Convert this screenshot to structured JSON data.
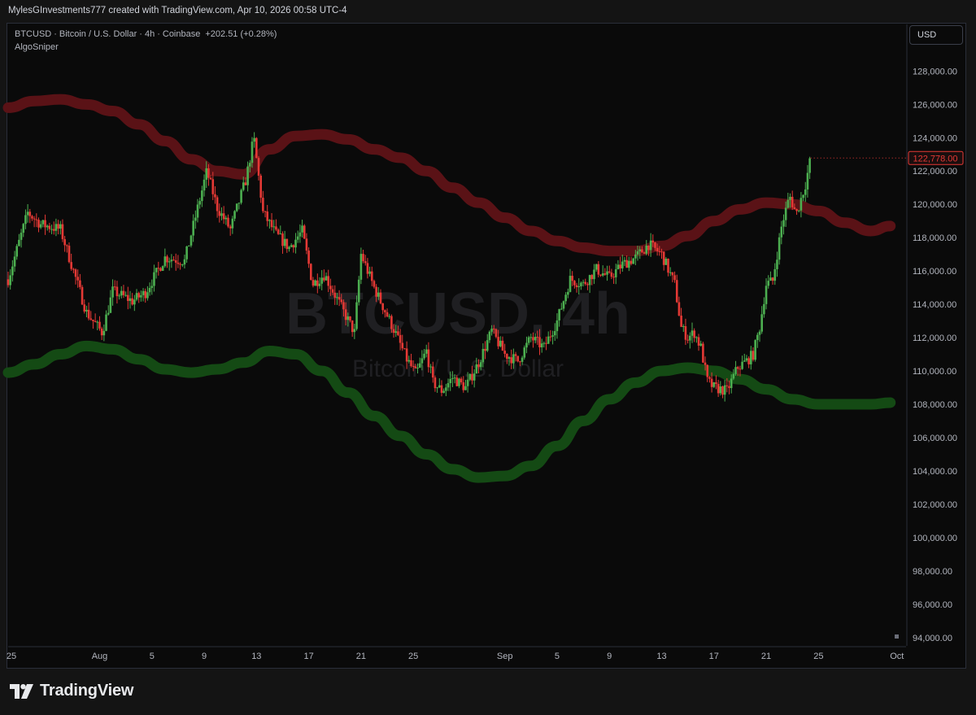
{
  "caption": "MylesGInvestments777 created with TradingView.com, Apr 10, 2026 00:58 UTC-4",
  "legend": {
    "symbol": "BTCUSD",
    "name": "Bitcoin / U.S. Dollar",
    "interval": "4h",
    "exchange": "Coinbase",
    "change": "+202.51 (+0.28%)",
    "indicator": "AlgoSniper"
  },
  "currency_button": "USD",
  "watermark": {
    "line1": "BTCUSD, 4h",
    "line2": "Bitcoin / U.S. Dollar"
  },
  "last_price_label": "122,778.00",
  "brand": "TradingView",
  "colors": {
    "background": "#0a0a0a",
    "up_candle": "#4caf50",
    "down_candle": "#e53935",
    "upper_band": "#5a1216",
    "lower_band": "#144a14",
    "price_label": "#e53935"
  },
  "chart_data": {
    "type": "candlestick",
    "symbol": "BTCUSD",
    "interval": "4h",
    "ylim": [
      93500,
      130800
    ],
    "y_ticks": [
      128000,
      126000,
      124000,
      122000,
      120000,
      118000,
      116000,
      114000,
      112000,
      110000,
      108000,
      106000,
      104000,
      102000,
      100000,
      98000,
      96000,
      94000
    ],
    "y_tick_labels": [
      "128,000.00",
      "126,000.00",
      "124,000.00",
      "122,000.00",
      "120,000.00",
      "118,000.00",
      "116,000.00",
      "114,000.00",
      "112,000.00",
      "110,000.00",
      "108,000.00",
      "106,000.00",
      "104,000.00",
      "102,000.00",
      "100,000.00",
      "98,000.00",
      "96,000.00",
      "94,000.00"
    ],
    "x_axis": {
      "start_day": 25,
      "labels": [
        {
          "text": "25",
          "day": 25
        },
        {
          "text": "Aug",
          "day": 32
        },
        {
          "text": "5",
          "day": 36
        },
        {
          "text": "9",
          "day": 40
        },
        {
          "text": "13",
          "day": 44
        },
        {
          "text": "17",
          "day": 48
        },
        {
          "text": "21",
          "day": 52
        },
        {
          "text": "25",
          "day": 56
        },
        {
          "text": "Sep",
          "day": 63
        },
        {
          "text": "5",
          "day": 67
        },
        {
          "text": "9",
          "day": 71
        },
        {
          "text": "13",
          "day": 75
        },
        {
          "text": "17",
          "day": 79
        },
        {
          "text": "21",
          "day": 83
        },
        {
          "text": "25",
          "day": 87
        },
        {
          "text": "Oct",
          "day": 93
        }
      ]
    },
    "price_path": [
      [
        25,
        115500
      ],
      [
        26.5,
        119500
      ],
      [
        27.5,
        118800
      ],
      [
        29,
        118500
      ],
      [
        30,
        116000
      ],
      [
        31,
        113500
      ],
      [
        32.2,
        112300
      ],
      [
        33,
        114800
      ],
      [
        34.5,
        114200
      ],
      [
        35.5,
        114700
      ],
      [
        37,
        116800
      ],
      [
        38.5,
        116600
      ],
      [
        40.2,
        122000
      ],
      [
        41,
        119800
      ],
      [
        42,
        118500
      ],
      [
        43.2,
        121500
      ],
      [
        43.8,
        124000
      ],
      [
        44.5,
        119500
      ],
      [
        45.5,
        118200
      ],
      [
        46.5,
        117400
      ],
      [
        47.5,
        118400
      ],
      [
        48.3,
        115200
      ],
      [
        49.2,
        115800
      ],
      [
        50.5,
        113800
      ],
      [
        51.5,
        112300
      ],
      [
        52,
        117000
      ],
      [
        53,
        115000
      ],
      [
        54.5,
        112500
      ],
      [
        55.5,
        110700
      ],
      [
        56.2,
        109800
      ],
      [
        57,
        111200
      ],
      [
        57.5,
        109300
      ],
      [
        58.2,
        108800
      ],
      [
        59,
        109600
      ],
      [
        60,
        109000
      ],
      [
        61,
        110500
      ],
      [
        62,
        112400
      ],
      [
        63,
        111000
      ],
      [
        64,
        110600
      ],
      [
        65,
        112000
      ],
      [
        66,
        111400
      ],
      [
        67,
        113000
      ],
      [
        68,
        115500
      ],
      [
        69,
        115200
      ],
      [
        70,
        116100
      ],
      [
        71,
        115600
      ],
      [
        72,
        116400
      ],
      [
        73,
        116800
      ],
      [
        74,
        117600
      ],
      [
        75,
        117000
      ],
      [
        76,
        115200
      ],
      [
        76.5,
        112600
      ],
      [
        77,
        112000
      ],
      [
        77.5,
        112300
      ],
      [
        78,
        111400
      ],
      [
        78.5,
        109400
      ],
      [
        79,
        109000
      ],
      [
        80,
        108800
      ],
      [
        80.8,
        110200
      ],
      [
        81.5,
        110600
      ],
      [
        82,
        111000
      ],
      [
        82.5,
        112600
      ],
      [
        83,
        115200
      ],
      [
        83.5,
        115400
      ],
      [
        84.2,
        118800
      ],
      [
        84.8,
        120500
      ],
      [
        85.3,
        119400
      ],
      [
        86,
        121200
      ],
      [
        86.4,
        122778
      ]
    ],
    "series": [
      {
        "name": "upper band",
        "x": [
          25,
          27,
          29,
          31,
          33,
          35,
          37,
          39,
          41,
          43,
          45,
          47,
          49,
          51,
          53,
          55,
          57,
          59,
          61,
          63,
          65,
          67,
          69,
          71,
          73,
          75,
          77,
          79,
          81,
          83,
          85,
          87,
          89,
          91,
          92.5
        ],
        "values": [
          125800,
          126200,
          126300,
          126000,
          125600,
          124800,
          123800,
          122700,
          122000,
          121800,
          123300,
          124100,
          124200,
          123900,
          123300,
          122800,
          122000,
          121000,
          120100,
          119200,
          118400,
          117800,
          117400,
          117200,
          117200,
          117500,
          118100,
          119000,
          119700,
          120100,
          120000,
          119600,
          118900,
          118400,
          118700
        ]
      },
      {
        "name": "lower band",
        "x": [
          25,
          27,
          29,
          31,
          33,
          35,
          37,
          39,
          41,
          43,
          45,
          47,
          49,
          51,
          53,
          55,
          57,
          59,
          61,
          63,
          65,
          67,
          69,
          71,
          73,
          75,
          77,
          79,
          81,
          83,
          85,
          87,
          89,
          91,
          92.5
        ],
        "values": [
          109900,
          110400,
          111000,
          111500,
          111300,
          110700,
          110100,
          109900,
          110100,
          110500,
          111200,
          111000,
          110000,
          108700,
          107300,
          106100,
          105000,
          104100,
          103600,
          103700,
          104300,
          105500,
          107000,
          108300,
          109300,
          110000,
          110200,
          110000,
          109500,
          108900,
          108300,
          108000,
          108000,
          108000,
          108100
        ]
      }
    ]
  }
}
